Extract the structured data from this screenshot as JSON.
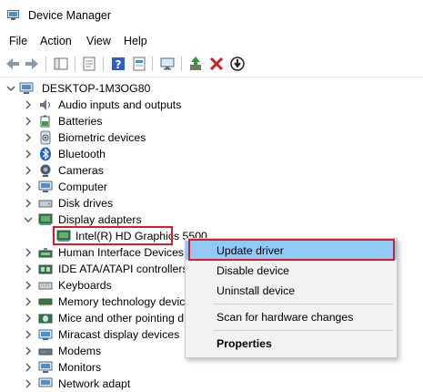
{
  "window": {
    "title": "Device Manager"
  },
  "menu": [
    "File",
    "Action",
    "View",
    "Help"
  ],
  "toolbar": {
    "buttons": [
      "back-arrow-icon",
      "forward-arrow-icon",
      "show-hide-tree-icon",
      "properties-sheet-icon",
      "help-icon",
      "action-sheet-icon",
      "monitor-scan-icon",
      "update-driver-icon",
      "uninstall-x-icon",
      "disable-device-icon"
    ]
  },
  "tree": {
    "root": "DESKTOP-1M3OG80",
    "items": [
      {
        "label": "Audio inputs and outputs",
        "icon": "speaker-icon"
      },
      {
        "label": "Batteries",
        "icon": "battery-icon"
      },
      {
        "label": "Biometric devices",
        "icon": "biometric-icon"
      },
      {
        "label": "Bluetooth",
        "icon": "bluetooth-icon"
      },
      {
        "label": "Cameras",
        "icon": "camera-icon"
      },
      {
        "label": "Computer",
        "icon": "computer-icon"
      },
      {
        "label": "Disk drives",
        "icon": "disk-drive-icon"
      },
      {
        "label": "Display adapters",
        "icon": "display-adapter-icon"
      },
      {
        "label": "Human Interface Devices",
        "icon": "hid-icon"
      },
      {
        "label": "IDE ATA/ATAPI controllers",
        "icon": "ide-controller-icon"
      },
      {
        "label": "Keyboards",
        "icon": "keyboard-icon"
      },
      {
        "label": "Memory technology devic",
        "icon": "memory-chip-icon"
      },
      {
        "label": "Mice and other pointing d",
        "icon": "mouse-icon"
      },
      {
        "label": "Miracast display devices",
        "icon": "miracast-icon"
      },
      {
        "label": "Modems",
        "icon": "modem-icon"
      },
      {
        "label": "Monitors",
        "icon": "monitor-icon"
      },
      {
        "label": "Network adapt",
        "icon": "network-adapter-icon"
      }
    ],
    "expanded_child": {
      "label": "Intel(R) HD Graphics 5500",
      "icon": "display-adapter-icon"
    }
  },
  "context_menu": {
    "items": [
      "Update driver",
      "Disable device",
      "Uninstall device",
      "Scan for hardware changes",
      "Properties"
    ]
  },
  "colors": {
    "highlight_border": "#d81c2b",
    "menu_hover": "#91c9f7",
    "menu_bg": "#f2f2f2"
  }
}
